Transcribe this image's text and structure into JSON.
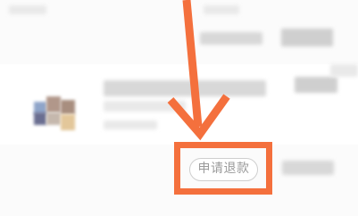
{
  "order": {
    "refund_button_label": "申请退款"
  },
  "annotation": {
    "arrow_color": "#f4703d",
    "highlight_color": "#f4703d"
  },
  "colors": {
    "button_border": "#cfcfcf",
    "button_text": "#9a9a9a",
    "background": "#fbfbfb"
  }
}
